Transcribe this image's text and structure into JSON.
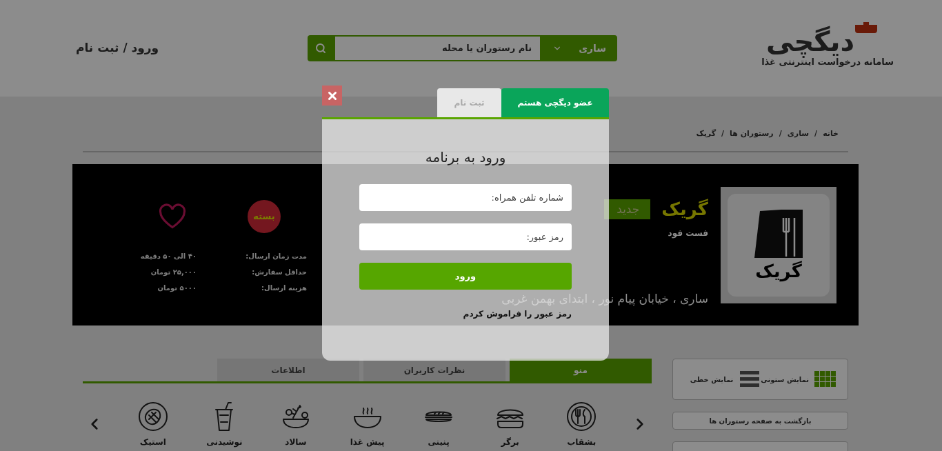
{
  "header": {
    "logo": {
      "name": "دیگچی",
      "tagline": "سامانه درخواست اینترنتی غذا"
    },
    "search": {
      "city": "ساری",
      "placeholder": "نام رستوران یا محله"
    },
    "auth_link": "ورود / ثبت نام"
  },
  "breadcrumb": {
    "separator": "/",
    "items": [
      "خانه",
      "ساری",
      "رستوران ها",
      "گریک"
    ]
  },
  "restaurant": {
    "logo_text": "گریک",
    "name": "گریک",
    "badge": "جدید",
    "category": "فست فود",
    "address": "ساری ، خیابان پیام نور ، ابتدای بهمن غربی",
    "status": "بسته",
    "favorite": false,
    "info": [
      {
        "label": "مدت زمان ارسال:",
        "value": "۴۰ الی ۵۰ دقیقه"
      },
      {
        "label": "حداقل سفارش:",
        "value": "۲۵,۰۰۰ تومان"
      },
      {
        "label": "هزینه ارسال:",
        "value": "۵۰۰۰ تومان"
      }
    ]
  },
  "view_options": [
    {
      "label": "نمایش ستونی",
      "selected": true
    },
    {
      "label": "نمایش خطی",
      "selected": false
    }
  ],
  "back_button": "بازگشت به صفحه رستوران ها",
  "tabs": [
    {
      "label": "منو",
      "selected": true
    },
    {
      "label": "نظرات کاربران",
      "selected": false
    },
    {
      "label": "اطلاعات",
      "selected": false
    }
  ],
  "categories": [
    "بشقاب",
    "برگر",
    "پنینی",
    "پیش غذا",
    "سالاد",
    "نوشیدنی",
    "استیک"
  ],
  "modal": {
    "tabs": [
      {
        "label": "عضو دیگچی هستم",
        "selected": true
      },
      {
        "label": "ثبت نام",
        "selected": false
      }
    ],
    "title": "ورود به برنامه",
    "fields": [
      {
        "placeholder": "شماره تلفن همراه:"
      },
      {
        "placeholder": "رمز عبور:"
      }
    ],
    "submit": "ورود",
    "forgot_link": "رمز عبور را فراموش کردم"
  }
}
